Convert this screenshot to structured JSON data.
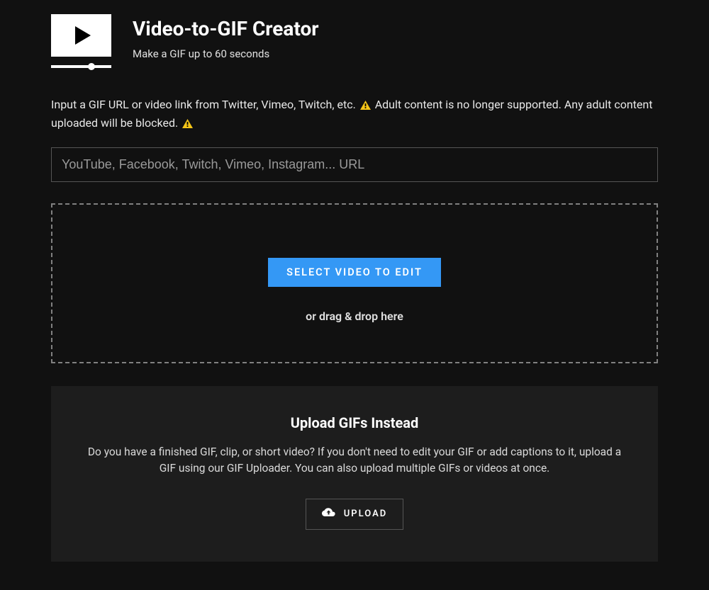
{
  "header": {
    "title": "Video-to-GIF Creator",
    "subtitle": "Make a GIF up to 60 seconds"
  },
  "instruction": {
    "part1": "Input a GIF URL or video link from Twitter, Vimeo, Twitch, etc.",
    "part2": "Adult content is no longer supported. Any adult content uploaded will be blocked."
  },
  "url_input": {
    "placeholder": "YouTube, Facebook, Twitch, Vimeo, Instagram... URL",
    "value": ""
  },
  "dropzone": {
    "button_label": "SELECT VIDEO TO EDIT",
    "hint": "or drag & drop here"
  },
  "upload_section": {
    "title": "Upload GIFs Instead",
    "description": "Do you have a finished GIF, clip, or short video? If you don't need to edit your GIF or add captions to it, upload a GIF using our GIF Uploader. You can also upload multiple GIFs or videos at once.",
    "button_label": "UPLOAD"
  }
}
